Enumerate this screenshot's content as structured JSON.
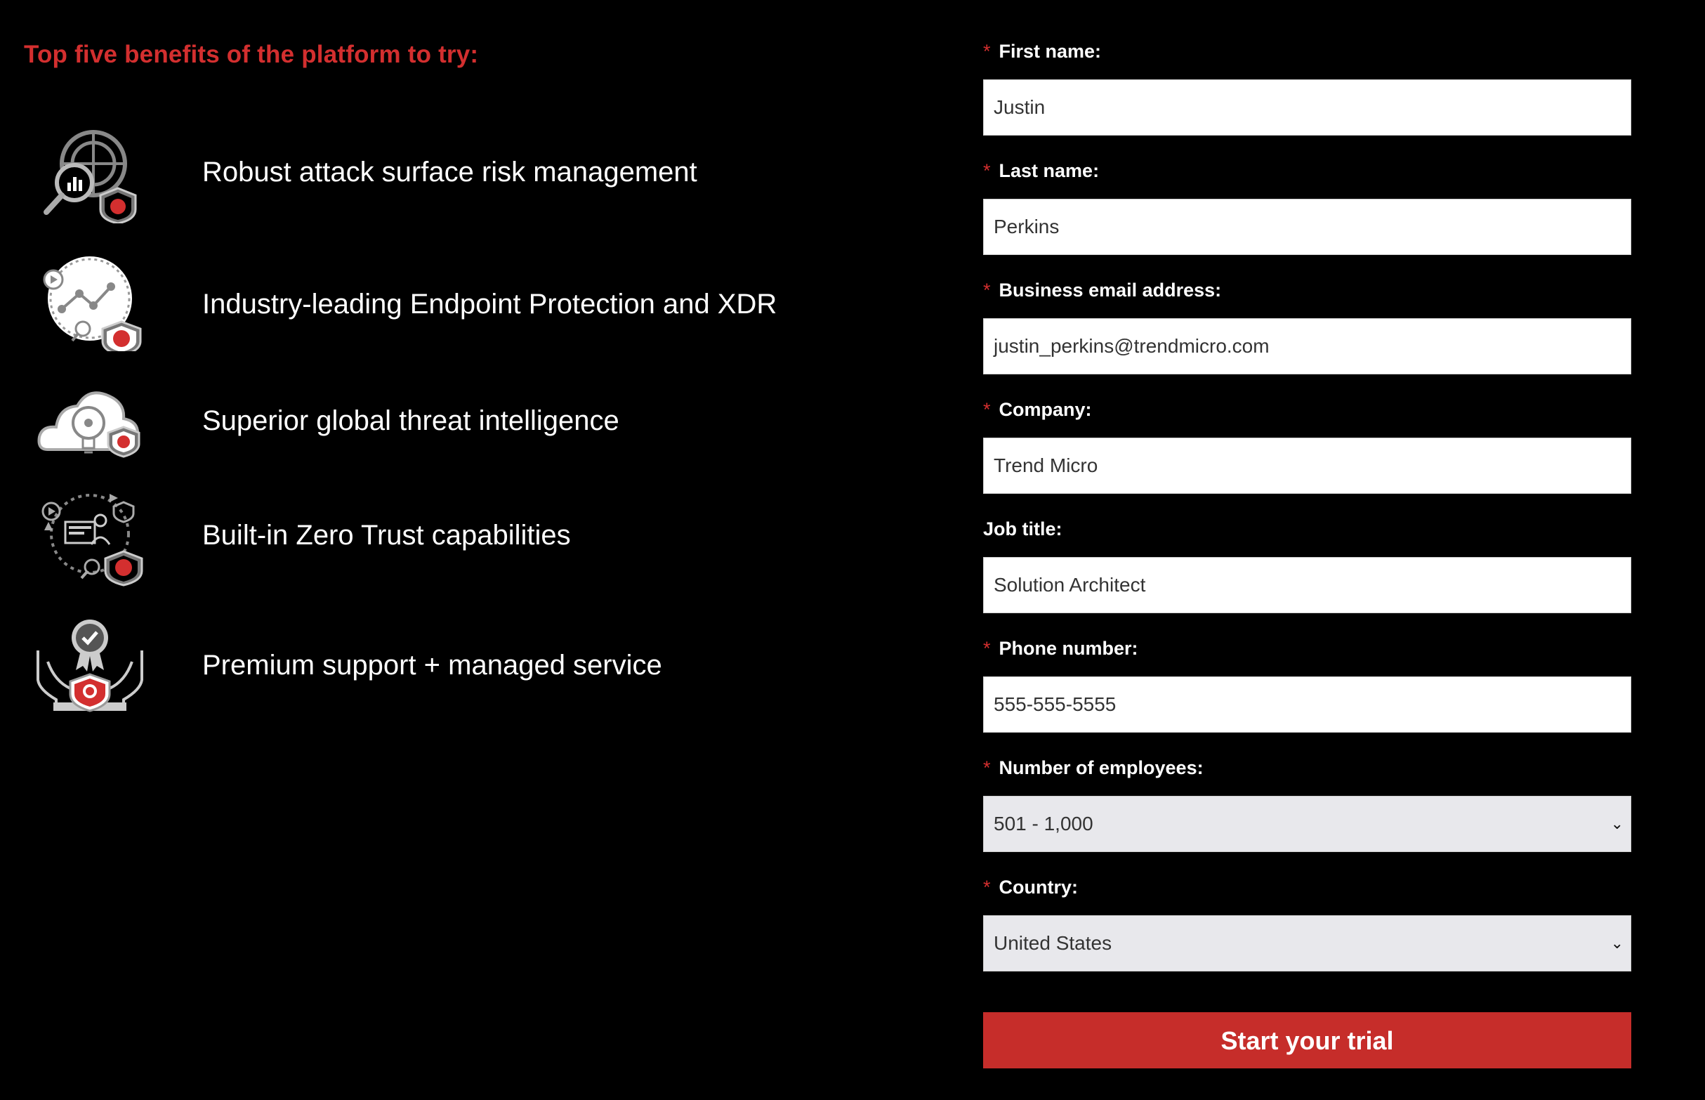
{
  "benefits": {
    "title": "Top five benefits of the platform to try:",
    "items": [
      {
        "label": "Robust attack surface risk management",
        "icon": "radar-magnifier-shield-icon"
      },
      {
        "label": "Industry-leading Endpoint Protection and XDR",
        "icon": "endpoint-analytics-shield-icon"
      },
      {
        "label": "Superior global threat intelligence",
        "icon": "cloud-lightbulb-shield-icon"
      },
      {
        "label": "Built-in Zero Trust capabilities",
        "icon": "zero-trust-cycle-shield-icon"
      },
      {
        "label": "Premium support + managed service",
        "icon": "award-hands-shield-icon"
      }
    ]
  },
  "form": {
    "required_marker": "*",
    "first_name": {
      "label": "First name:",
      "value": "Justin"
    },
    "last_name": {
      "label": "Last name:",
      "value": "Perkins"
    },
    "email": {
      "label": "Business email address:",
      "value": "justin_perkins@trendmicro.com"
    },
    "company": {
      "label": "Company:",
      "value": "Trend Micro"
    },
    "job_title": {
      "label": "Job title:",
      "value": "Solution Architect"
    },
    "phone": {
      "label": "Phone number:",
      "value": "555-555-5555"
    },
    "employees": {
      "label": "Number of employees:",
      "value": "501 - 1,000"
    },
    "country": {
      "label": "Country:",
      "value": "United States"
    },
    "submit_label": "Start your trial"
  },
  "colors": {
    "accent": "#d32f2f",
    "button": "#c62d2a",
    "background": "#000000",
    "select_bg": "#e8e8ec"
  }
}
